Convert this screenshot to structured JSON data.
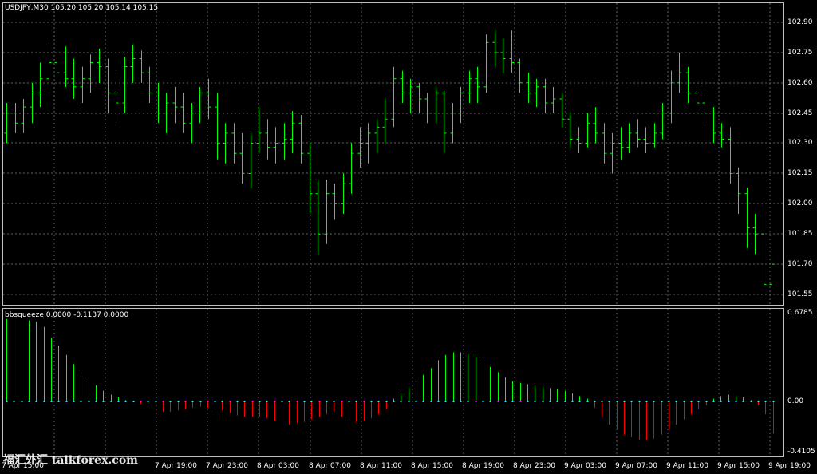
{
  "main_chart": {
    "title": "USDJPY,M30  105.20 105.20 105.14 105.15",
    "price_labels": [
      "102.90",
      "102.75",
      "102.60",
      "102.45",
      "102.30",
      "102.15",
      "102.00",
      "101.85",
      "101.70",
      "101.55"
    ]
  },
  "indicator": {
    "title": "bbsqueeze 0.0000 -0.1137 0.0000",
    "axis_labels": [
      "0.6785",
      "0.00",
      "-0.4105"
    ]
  },
  "time_labels": [
    "7 Apr 15:00",
    "7 Apr 19:00",
    "7 Apr 23:00",
    "8 Apr 03:00",
    "8 Apr 07:00",
    "8 Apr 11:00",
    "8 Apr 15:00",
    "8 Apr 19:00",
    "8 Apr 23:00",
    "9 Apr 03:00",
    "9 Apr 07:00",
    "9 Apr 11:00",
    "9 Apr 15:00",
    "9 Apr 19:00"
  ],
  "watermark": "福汇外汇 talkforex.com",
  "colors": {
    "background": "#000000",
    "bars": "#00ff00",
    "positive_histogram": "#00ff00",
    "negative_histogram": "#ff0000",
    "zero_dots_a": "#00ffff",
    "zero_dots_b": "#ff00ff",
    "grid": "#606060"
  },
  "chart_data": [
    {
      "type": "bar",
      "title": "USDJPY,M30",
      "ylim": [
        101.5,
        102.97
      ],
      "ohlc": [
        [
          102.35,
          102.5,
          102.3,
          102.45
        ],
        [
          102.45,
          102.5,
          102.35,
          102.4
        ],
        [
          102.4,
          102.52,
          102.35,
          102.48
        ],
        [
          102.48,
          102.6,
          102.4,
          102.55
        ],
        [
          102.55,
          102.7,
          102.48,
          102.62
        ],
        [
          102.62,
          102.8,
          102.55,
          102.7
        ],
        [
          102.7,
          102.86,
          102.6,
          102.65
        ],
        [
          102.65,
          102.78,
          102.58,
          102.62
        ],
        [
          102.62,
          102.72,
          102.52,
          102.58
        ],
        [
          102.58,
          102.68,
          102.5,
          102.62
        ],
        [
          102.62,
          102.74,
          102.55,
          102.7
        ],
        [
          102.7,
          102.77,
          102.6,
          102.68
        ],
        [
          102.68,
          102.72,
          102.45,
          102.55
        ],
        [
          102.55,
          102.65,
          102.4,
          102.5
        ],
        [
          102.5,
          102.73,
          102.45,
          102.68
        ],
        [
          102.68,
          102.79,
          102.6,
          102.72
        ],
        [
          102.72,
          102.76,
          102.6,
          102.65
        ],
        [
          102.65,
          102.68,
          102.5,
          102.55
        ],
        [
          102.55,
          102.6,
          102.4,
          102.45
        ],
        [
          102.45,
          102.55,
          102.35,
          102.5
        ],
        [
          102.5,
          102.58,
          102.4,
          102.48
        ],
        [
          102.48,
          102.55,
          102.35,
          102.4
        ],
        [
          102.4,
          102.5,
          102.3,
          102.45
        ],
        [
          102.45,
          102.58,
          102.4,
          102.55
        ],
        [
          102.55,
          102.62,
          102.42,
          102.48
        ],
        [
          102.48,
          102.55,
          102.22,
          102.3
        ],
        [
          102.3,
          102.4,
          102.2,
          102.35
        ],
        [
          102.35,
          102.4,
          102.2,
          102.25
        ],
        [
          102.25,
          102.35,
          102.1,
          102.15
        ],
        [
          102.15,
          102.35,
          102.08,
          102.3
        ],
        [
          102.3,
          102.48,
          102.25,
          102.35
        ],
        [
          102.35,
          102.42,
          102.22,
          102.28
        ],
        [
          102.28,
          102.38,
          102.2,
          102.3
        ],
        [
          102.3,
          102.4,
          102.22,
          102.32
        ],
        [
          102.32,
          102.46,
          102.25,
          102.4
        ],
        [
          102.4,
          102.44,
          102.2,
          102.25
        ],
        [
          102.25,
          102.3,
          101.95,
          102.05
        ],
        [
          102.05,
          102.12,
          101.75,
          101.85
        ],
        [
          101.85,
          102.12,
          101.8,
          102.05
        ],
        [
          102.05,
          102.1,
          101.92,
          102.0
        ],
        [
          102.0,
          102.15,
          101.95,
          102.1
        ],
        [
          102.1,
          102.3,
          102.05,
          102.25
        ],
        [
          102.25,
          102.38,
          102.18,
          102.3
        ],
        [
          102.3,
          102.4,
          102.2,
          102.35
        ],
        [
          102.35,
          102.42,
          102.25,
          102.38
        ],
        [
          102.38,
          102.52,
          102.3,
          102.42
        ],
        [
          102.42,
          102.68,
          102.38,
          102.62
        ],
        [
          102.62,
          102.66,
          102.5,
          102.55
        ],
        [
          102.55,
          102.62,
          102.45,
          102.58
        ],
        [
          102.58,
          102.6,
          102.45,
          102.52
        ],
        [
          102.52,
          102.55,
          102.4,
          102.45
        ],
        [
          102.45,
          102.58,
          102.4,
          102.55
        ],
        [
          102.55,
          102.56,
          102.25,
          102.35
        ],
        [
          102.35,
          102.5,
          102.3,
          102.45
        ],
        [
          102.45,
          102.58,
          102.4,
          102.55
        ],
        [
          102.55,
          102.66,
          102.5,
          102.62
        ],
        [
          102.62,
          102.68,
          102.5,
          102.58
        ],
        [
          102.58,
          102.84,
          102.55,
          102.8
        ],
        [
          102.8,
          102.86,
          102.68,
          102.75
        ],
        [
          102.75,
          102.82,
          102.65,
          102.72
        ],
        [
          102.72,
          102.86,
          102.65,
          102.7
        ],
        [
          102.7,
          102.72,
          102.55,
          102.6
        ],
        [
          102.6,
          102.65,
          102.5,
          102.55
        ],
        [
          102.55,
          102.62,
          102.48,
          102.58
        ],
        [
          102.58,
          102.62,
          102.45,
          102.5
        ],
        [
          102.5,
          102.58,
          102.45,
          102.52
        ],
        [
          102.52,
          102.55,
          102.38,
          102.42
        ],
        [
          102.42,
          102.45,
          102.28,
          102.32
        ],
        [
          102.32,
          102.38,
          102.25,
          102.3
        ],
        [
          102.3,
          102.45,
          102.28,
          102.4
        ],
        [
          102.4,
          102.48,
          102.3,
          102.35
        ],
        [
          102.35,
          102.4,
          102.2,
          102.25
        ],
        [
          102.25,
          102.35,
          102.15,
          102.3
        ],
        [
          102.3,
          102.38,
          102.22,
          102.28
        ],
        [
          102.28,
          102.4,
          102.25,
          102.35
        ],
        [
          102.35,
          102.42,
          102.28,
          102.32
        ],
        [
          102.32,
          102.38,
          102.25,
          102.3
        ],
        [
          102.3,
          102.4,
          102.28,
          102.35
        ],
        [
          102.35,
          102.5,
          102.32,
          102.45
        ],
        [
          102.45,
          102.66,
          102.4,
          102.6
        ],
        [
          102.6,
          102.75,
          102.55,
          102.65
        ],
        [
          102.65,
          102.68,
          102.5,
          102.55
        ],
        [
          102.55,
          102.58,
          102.45,
          102.5
        ],
        [
          102.5,
          102.55,
          102.4,
          102.45
        ],
        [
          102.45,
          102.48,
          102.3,
          102.35
        ],
        [
          102.35,
          102.4,
          102.28,
          102.32
        ],
        [
          102.32,
          102.38,
          102.1,
          102.15
        ],
        [
          102.15,
          102.18,
          101.95,
          102.05
        ],
        [
          102.05,
          102.08,
          101.78,
          101.88
        ],
        [
          101.88,
          101.95,
          101.75,
          101.85
        ],
        [
          101.85,
          102.0,
          101.55,
          101.6
        ],
        [
          101.6,
          101.75,
          101.55,
          101.7
        ]
      ]
    },
    {
      "type": "bar",
      "title": "bbsqueeze",
      "ylim": [
        -0.4105,
        0.6785
      ],
      "values": [
        0.62,
        0.62,
        0.62,
        0.61,
        0.6,
        0.56,
        0.48,
        0.42,
        0.35,
        0.28,
        0.22,
        0.18,
        0.12,
        0.08,
        0.05,
        0.03,
        0.01,
        0.0,
        -0.02,
        -0.05,
        -0.07,
        -0.08,
        -0.08,
        -0.07,
        -0.06,
        -0.05,
        -0.04,
        -0.05,
        -0.06,
        -0.07,
        -0.09,
        -0.11,
        -0.12,
        -0.12,
        -0.12,
        -0.13,
        -0.15,
        -0.17,
        -0.18,
        -0.17,
        -0.16,
        -0.14,
        -0.12,
        -0.1,
        -0.08,
        -0.12,
        -0.15,
        -0.16,
        -0.15,
        -0.13,
        -0.1,
        -0.06,
        0.02,
        0.06,
        0.1,
        0.15,
        0.2,
        0.25,
        0.31,
        0.35,
        0.37,
        0.37,
        0.36,
        0.34,
        0.3,
        0.26,
        0.22,
        0.18,
        0.15,
        0.14,
        0.13,
        0.12,
        0.11,
        0.1,
        0.09,
        0.08,
        0.06,
        0.04,
        0.02,
        -0.05,
        -0.12,
        -0.18,
        -0.22,
        -0.26,
        -0.28,
        -0.3,
        -0.3,
        -0.29,
        -0.26,
        -0.22,
        -0.18,
        -0.14,
        -0.1,
        -0.06,
        -0.03,
        0.02,
        0.04,
        0.05,
        0.04,
        0.03,
        0.01,
        -0.03,
        -0.1,
        -0.25
      ]
    }
  ]
}
